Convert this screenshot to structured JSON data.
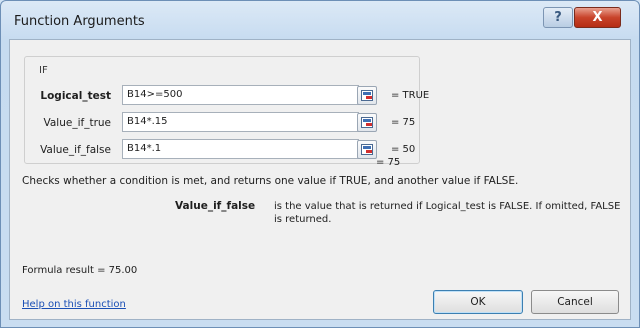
{
  "window": {
    "title": "Function Arguments",
    "help_glyph": "?",
    "close_glyph": "X"
  },
  "function_name": "IF",
  "arguments": [
    {
      "label": "Logical_test",
      "value": "B14>=500",
      "result": "=  TRUE"
    },
    {
      "label": "Value_if_true",
      "value": "B14*.15",
      "result": "=  75"
    },
    {
      "label": "Value_if_false",
      "value": "B14*.1",
      "result": "=  50"
    }
  ],
  "overall_result": "=  75",
  "description": "Checks whether a condition is met, and returns one value if TRUE, and another value if FALSE.",
  "argument_help": {
    "name": "Value_if_false",
    "text": "is the value that is returned if Logical_test is FALSE. If omitted, FALSE is returned."
  },
  "formula_result": "Formula result =   75.00",
  "help_link": "Help on this function",
  "buttons": {
    "ok": "OK",
    "cancel": "Cancel"
  }
}
